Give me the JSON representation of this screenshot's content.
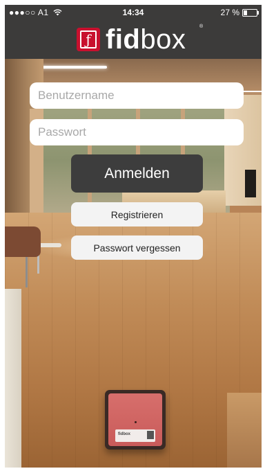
{
  "status_bar": {
    "carrier": "●●●○○ A1",
    "wifi_icon": "wifi-icon",
    "time": "14:34",
    "battery_percent": "27 %",
    "battery_level": 0.27
  },
  "header": {
    "logo_mark": "ƒ",
    "logo_text_bold": "fid",
    "logo_text_light": "box",
    "logo_registered": "®",
    "brand_color": "#c8102e",
    "bar_color": "#3c3b3a"
  },
  "form": {
    "username_placeholder": "Benutzername",
    "username_value": "",
    "password_placeholder": "Passwort",
    "password_value": "",
    "login_label": "Anmelden",
    "register_label": "Registrieren",
    "forgot_label": "Passwort vergessen"
  },
  "background": {
    "scale_label_brand": "fidbox"
  }
}
